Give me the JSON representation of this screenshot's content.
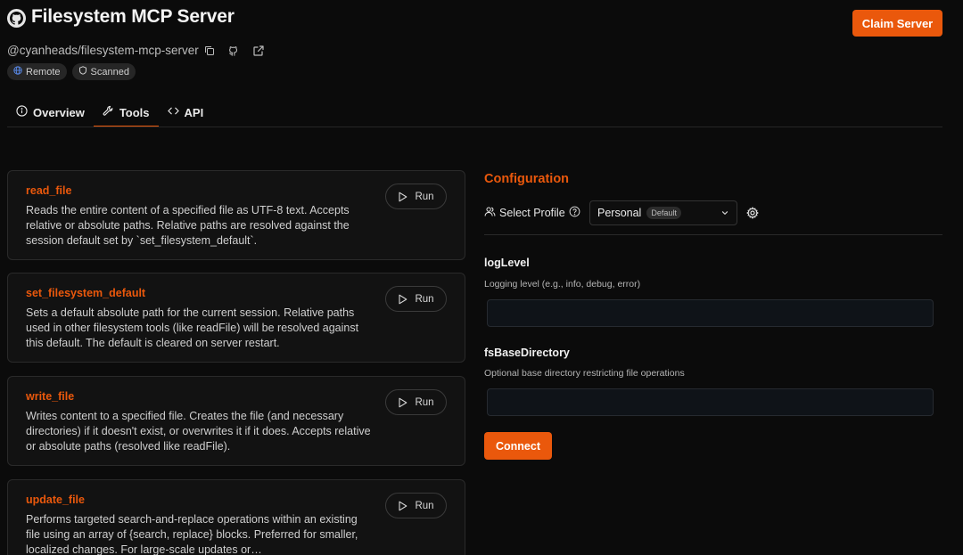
{
  "header": {
    "title": "Filesystem MCP Server",
    "claim_label": "Claim Server",
    "repo": "@cyanheads/filesystem-mcp-server",
    "accent": "#ea580c"
  },
  "badges": [
    {
      "label": "Remote",
      "icon": "globe-icon"
    },
    {
      "label": "Scanned",
      "icon": "shield-icon"
    }
  ],
  "tabs": [
    {
      "label": "Overview",
      "icon": "info-icon"
    },
    {
      "label": "Tools",
      "icon": "wrench-icon",
      "active": true
    },
    {
      "label": "API",
      "icon": "code-icon"
    }
  ],
  "tools": [
    {
      "name": "read_file",
      "description": "Reads the entire content of a specified file as UTF-8 text. Accepts relative or absolute paths. Relative paths are resolved against the session default set by `set_filesystem_default`.",
      "run_label": "Run"
    },
    {
      "name": "set_filesystem_default",
      "description": "Sets a default absolute path for the current session. Relative paths used in other filesystem tools (like readFile) will be resolved against this default. The default is cleared on server restart.",
      "run_label": "Run"
    },
    {
      "name": "write_file",
      "description": "Writes content to a specified file. Creates the file (and necessary directories) if it doesn't exist, or overwrites it if it does. Accepts relative or absolute paths (resolved like readFile).",
      "run_label": "Run"
    },
    {
      "name": "update_file",
      "description": "Performs targeted search-and-replace operations within an existing file using an array of {search, replace} blocks. Preferred for smaller, localized changes. For large-scale updates or…",
      "run_label": "Run"
    }
  ],
  "config": {
    "title": "Configuration",
    "profile_label": "Select Profile",
    "profile_value": "Personal",
    "profile_pill": "Default",
    "fields": [
      {
        "label": "logLevel",
        "help": "Logging level (e.g., info, debug, error)",
        "value": ""
      },
      {
        "label": "fsBaseDirectory",
        "help": "Optional base directory restricting file operations",
        "value": ""
      }
    ],
    "connect_label": "Connect"
  }
}
